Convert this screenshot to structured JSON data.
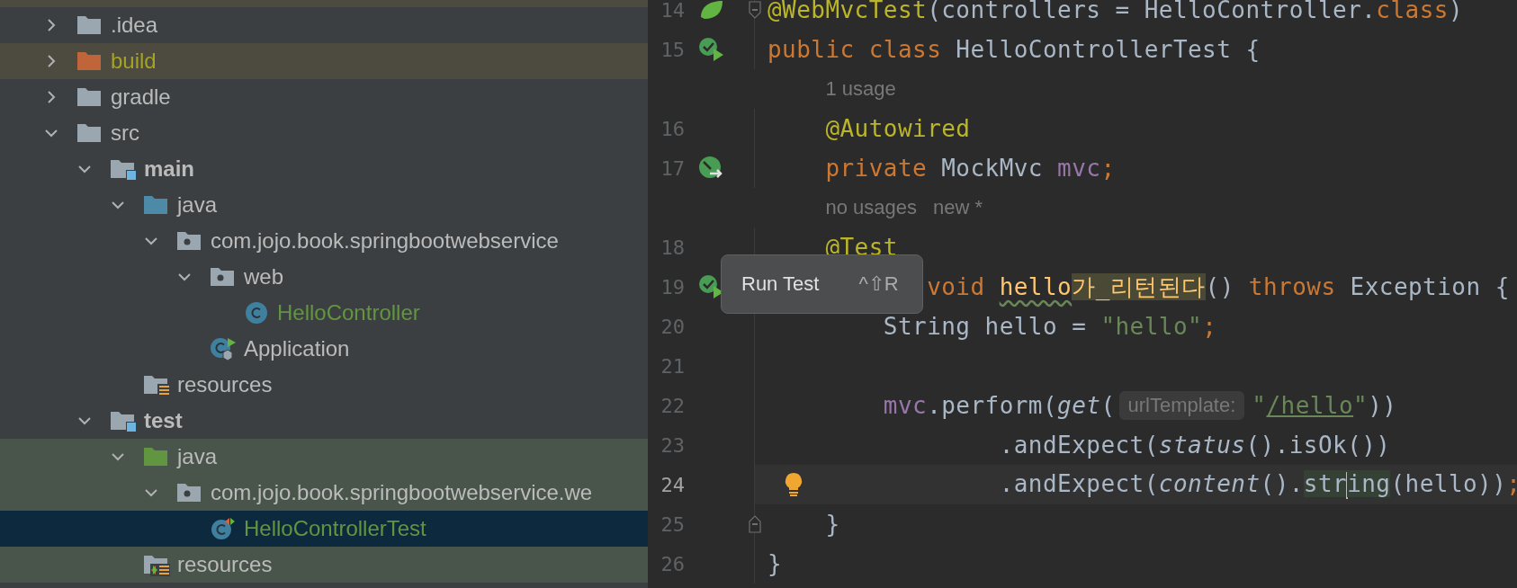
{
  "project_tree": {
    "items": [
      {
        "label": ".idea",
        "kind": "folder",
        "expanded": false,
        "selected": false
      },
      {
        "label": "build",
        "kind": "excluded-folder",
        "excluded": true,
        "expanded": false,
        "selected": false
      },
      {
        "label": "gradle",
        "kind": "folder",
        "expanded": false,
        "selected": false
      },
      {
        "label": "src",
        "kind": "folder",
        "expanded": true,
        "selected": false,
        "children": [
          {
            "label": "main",
            "kind": "source-set",
            "expanded": true,
            "selected": false,
            "children": [
              {
                "label": "java",
                "kind": "source-root",
                "expanded": true,
                "selected": false,
                "children": [
                  {
                    "label": "com.jojo.book.springbootwebservice",
                    "kind": "package",
                    "expanded": true,
                    "selected": false,
                    "children": [
                      {
                        "label": "web",
                        "kind": "package",
                        "expanded": true,
                        "selected": false,
                        "children": [
                          {
                            "label": "HelloController",
                            "kind": "class",
                            "added": true,
                            "selected": false
                          }
                        ]
                      },
                      {
                        "label": "Application",
                        "kind": "spring-app",
                        "selected": false
                      }
                    ]
                  }
                ]
              },
              {
                "label": "resources",
                "kind": "resources",
                "selected": false
              }
            ]
          },
          {
            "label": "test",
            "kind": "source-set",
            "expanded": true,
            "selected": false,
            "children": [
              {
                "label": "java",
                "kind": "test-root",
                "in_test_scope": true,
                "expanded": true,
                "selected": false,
                "children": [
                  {
                    "label": "com.jojo.book.springbootwebservice.we",
                    "kind": "package",
                    "in_test_scope": true,
                    "expanded": true,
                    "selected": false,
                    "children": [
                      {
                        "label": "HelloControllerTest",
                        "kind": "test-class",
                        "in_test_scope": true,
                        "added": true,
                        "selected": true
                      }
                    ]
                  }
                ]
              },
              {
                "label": "resources",
                "kind": "test-resources",
                "in_test_scope": true,
                "selected": false
              }
            ]
          }
        ]
      }
    ]
  },
  "editor": {
    "lines": [
      {
        "kind": "code",
        "number": "14",
        "gutter": {
          "kind": "spring-leaf"
        },
        "fold_start": true,
        "segments": [
          {
            "kind": "code",
            "tokens": [
              {
                "kind": "annotation",
                "text": "@WebMvcTest"
              },
              {
                "kind": "plain",
                "text": "(controllers = HelloController."
              },
              {
                "kind": "keyword",
                "text": "class"
              },
              {
                "kind": "plain",
                "text": ")"
              }
            ]
          }
        ]
      },
      {
        "kind": "code",
        "number": "15",
        "gutter": {
          "kind": "run-test"
        },
        "segments": [
          {
            "kind": "code",
            "tokens": [
              {
                "kind": "keyword",
                "text": "public class "
              },
              {
                "kind": "plain",
                "text": "HelloControllerTest {"
              }
            ]
          }
        ]
      },
      {
        "kind": "inlay",
        "hints": [
          "1 usage"
        ]
      },
      {
        "kind": "code",
        "number": "16",
        "segments": [
          {
            "kind": "code",
            "tokens": [
              {
                "kind": "annotation",
                "text": "    @Autowired"
              }
            ]
          }
        ]
      },
      {
        "kind": "code",
        "number": "17",
        "gutter": {
          "kind": "bean"
        },
        "segments": [
          {
            "kind": "code",
            "tokens": [
              {
                "kind": "keyword",
                "text": "    private "
              },
              {
                "kind": "plain",
                "text": "MockMvc "
              },
              {
                "kind": "field",
                "text": "mvc"
              },
              {
                "kind": "keyword",
                "text": ";"
              }
            ]
          }
        ]
      },
      {
        "kind": "inlay",
        "hints": [
          "no usages",
          "new *"
        ]
      },
      {
        "kind": "code",
        "number": "18",
        "segments": [
          {
            "kind": "code",
            "tokens": [
              {
                "kind": "annotation",
                "text": "    @Test"
              }
            ]
          }
        ]
      },
      {
        "kind": "code",
        "number": "19",
        "gutter": {
          "kind": "run-test"
        },
        "segments": [
          {
            "kind": "code",
            "tokens": [
              {
                "kind": "keyword",
                "text": "           void "
              },
              {
                "kind": "method-typo",
                "text": "hello"
              },
              {
                "kind": "method-match",
                "text": "가_리턴된다"
              },
              {
                "kind": "plain",
                "text": "() "
              },
              {
                "kind": "keyword",
                "text": "throws "
              },
              {
                "kind": "plain",
                "text": "Exception {"
              }
            ]
          }
        ]
      },
      {
        "kind": "code",
        "number": "20",
        "segments": [
          {
            "kind": "code",
            "tokens": [
              {
                "kind": "plain",
                "text": "        String hello = "
              },
              {
                "kind": "string",
                "text": "\"hello\""
              },
              {
                "kind": "keyword",
                "text": ";"
              }
            ]
          }
        ]
      },
      {
        "kind": "code",
        "number": "21"
      },
      {
        "kind": "code",
        "number": "22",
        "segments": [
          {
            "kind": "code",
            "tokens": [
              {
                "kind": "field",
                "text": "        mvc"
              },
              {
                "kind": "plain",
                "text": ".perform("
              },
              {
                "kind": "static",
                "text": "get"
              },
              {
                "kind": "plain",
                "text": "("
              }
            ]
          },
          {
            "kind": "hint",
            "text": "urlTemplate:"
          },
          {
            "kind": "code",
            "tokens": [
              {
                "kind": "string",
                "text": "\""
              },
              {
                "kind": "link-string",
                "text": "/hello"
              },
              {
                "kind": "string",
                "text": "\""
              },
              {
                "kind": "plain",
                "text": "))"
              }
            ]
          }
        ]
      },
      {
        "kind": "code",
        "number": "23",
        "segments": [
          {
            "kind": "code",
            "tokens": [
              {
                "kind": "plain",
                "text": "                .andExpect("
              },
              {
                "kind": "static",
                "text": "status"
              },
              {
                "kind": "plain",
                "text": "().isOk())"
              }
            ]
          }
        ]
      },
      {
        "kind": "code",
        "number": "24",
        "current": true,
        "gutter": {
          "kind": "bulb"
        },
        "segments": [
          {
            "kind": "code",
            "tokens": [
              {
                "kind": "plain",
                "text": "                .andExpect("
              },
              {
                "kind": "static",
                "text": "content"
              },
              {
                "kind": "plain",
                "text": "()."
              },
              {
                "kind": "match",
                "text": "str",
                "cursor_after": true
              },
              {
                "kind": "match",
                "text": "ing"
              },
              {
                "kind": "plain",
                "text": "(hello))"
              },
              {
                "kind": "keyword",
                "text": ";"
              }
            ]
          }
        ]
      },
      {
        "kind": "code",
        "number": "25",
        "fold_end": true,
        "segments": [
          {
            "kind": "code",
            "tokens": [
              {
                "kind": "plain",
                "text": "    }"
              }
            ]
          }
        ]
      },
      {
        "kind": "code",
        "number": "26",
        "segments": [
          {
            "kind": "code",
            "tokens": [
              {
                "kind": "plain",
                "text": "}"
              }
            ]
          }
        ]
      }
    ],
    "tooltip": {
      "label": "Run Test",
      "shortcut": "^⇧R"
    }
  }
}
